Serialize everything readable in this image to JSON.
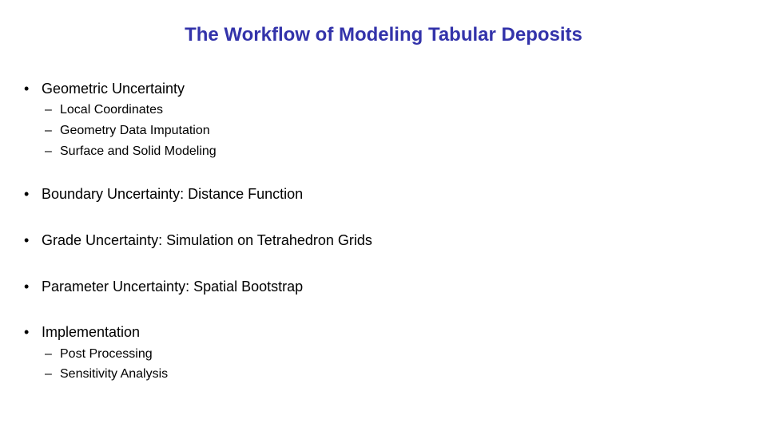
{
  "title": "The Workflow of Modeling Tabular Deposits",
  "bullets": [
    {
      "text": "Geometric Uncertainty",
      "sub": [
        "Local Coordinates",
        "Geometry Data Imputation",
        "Surface and Solid Modeling"
      ]
    },
    {
      "text": "Boundary Uncertainty: Distance Function",
      "sub": []
    },
    {
      "text": "Grade Uncertainty: Simulation on Tetrahedron Grids",
      "sub": []
    },
    {
      "text": "Parameter Uncertainty: Spatial Bootstrap",
      "sub": []
    },
    {
      "text": "Implementation",
      "sub": [
        "Post Processing",
        "Sensitivity Analysis"
      ]
    }
  ],
  "bullet_glyph": "•",
  "dash_glyph": "–",
  "colors": {
    "title": "#3333aa",
    "text": "#000000"
  }
}
